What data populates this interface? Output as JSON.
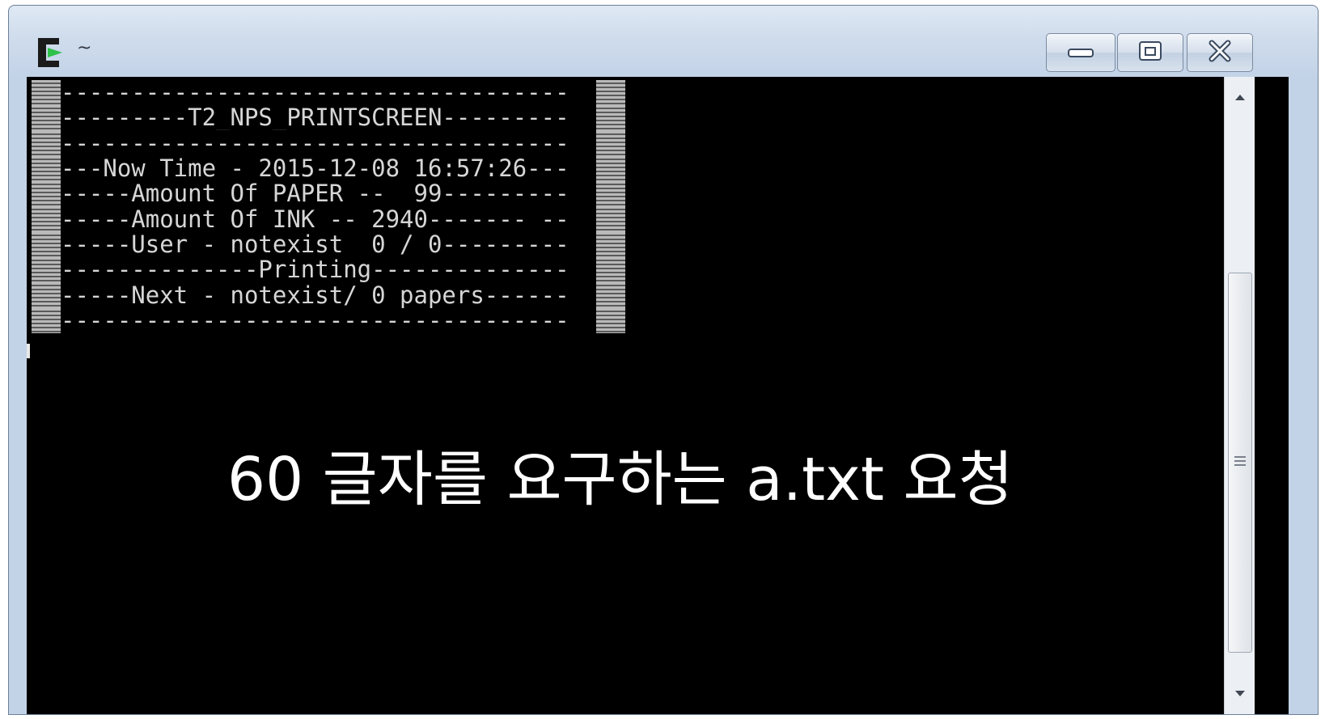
{
  "window": {
    "title": "~",
    "controls": {
      "minimize": "minimize-icon",
      "maximize": "restore-icon",
      "close": "close-icon"
    }
  },
  "terminal": {
    "lines": [
      "------------------------------------",
      "---------T2_NPS_PRINTSCREEN---------",
      "------------------------------------",
      "---Now Time - 2015-12-08 16:57:26---",
      "-----Amount Of PAPER --  99---------",
      "-----Amount Of INK -- 2940------- --",
      "-----User - notexist  0 / 0---------",
      "--------------Printing--------------",
      "-----Next - notexist/ 0 papers------",
      "------------------------------------"
    ],
    "caption": "60 글자를 요구하는 a.txt 요청"
  },
  "colors": {
    "terminal_bg": "#000000",
    "terminal_text": "#d6d6d6",
    "caption_text": "#ffffff",
    "icon_green": "#2fc14a"
  }
}
